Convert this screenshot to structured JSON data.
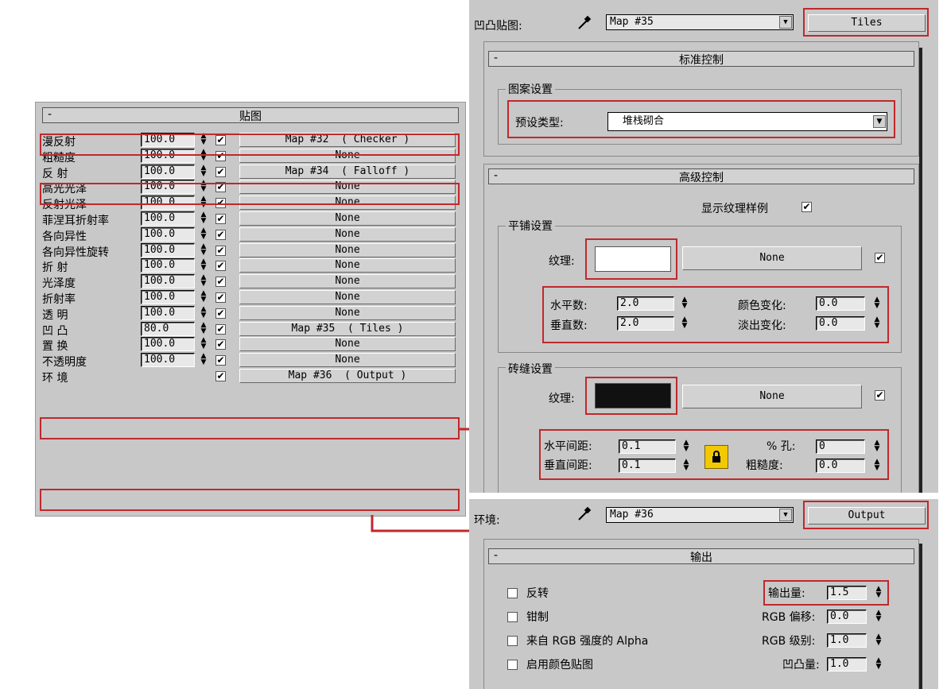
{
  "maps_rollout": {
    "collapse": "-",
    "title": "贴图",
    "rows": [
      {
        "label": "漫反射",
        "amount": "100.0",
        "map": "Map #32  ( Checker )"
      },
      {
        "label": "粗糙度",
        "amount": "100.0",
        "map": "None"
      },
      {
        "label": "反  射",
        "amount": "100.0",
        "map": "Map #34  ( Falloff )"
      },
      {
        "label": "高光光泽",
        "amount": "100.0",
        "map": "None"
      },
      {
        "label": "反射光泽",
        "amount": "100.0",
        "map": "None"
      },
      {
        "label": "菲涅耳折射率",
        "amount": "100.0",
        "map": "None"
      },
      {
        "label": "各向异性",
        "amount": "100.0",
        "map": "None"
      },
      {
        "label": "各向异性旋转",
        "amount": "100.0",
        "map": "None"
      },
      {
        "label": "折  射",
        "amount": "100.0",
        "map": "None"
      },
      {
        "label": "光泽度",
        "amount": "100.0",
        "map": "None"
      },
      {
        "label": "折射率",
        "amount": "100.0",
        "map": "None"
      },
      {
        "label": "透  明",
        "amount": "100.0",
        "map": "None"
      },
      {
        "label": "凹  凸",
        "amount": "80.0",
        "map": "Map #35  ( Tiles )"
      },
      {
        "label": "置  换",
        "amount": "100.0",
        "map": "None"
      },
      {
        "label": "不透明度",
        "amount": "100.0",
        "map": "None"
      },
      {
        "label": "环  境",
        "amount": "",
        "map": "Map #36  ( Output )"
      }
    ]
  },
  "bump_panel": {
    "label": "凹凸贴图:",
    "map_name": "Map #35",
    "type_button": "Tiles",
    "std_rollout": {
      "collapse": "-",
      "title": "标准控制",
      "pattern_group": "图案设置",
      "preset_label": "预设类型:",
      "preset_value": "堆栈砌合"
    },
    "adv_rollout": {
      "collapse": "-",
      "title": "高级控制",
      "show_sample_label": "显示纹理样例",
      "tiles_group": "平铺设置",
      "tiles_texture_label": "纹理:",
      "tiles_texture_map": "None",
      "horiz_count_label": "水平数:",
      "horiz_count": "2.0",
      "vert_count_label": "垂直数:",
      "vert_count": "2.0",
      "color_var_label": "颜色变化:",
      "color_var": "0.0",
      "fade_var_label": "淡出变化:",
      "fade_var": "0.0",
      "grout_group": "砖缝设置",
      "grout_texture_label": "纹理:",
      "grout_texture_map": "None",
      "horiz_gap_label": "水平间距:",
      "horiz_gap": "0.1",
      "vert_gap_label": "垂直间距:",
      "vert_gap": "0.1",
      "holes_label": "% 孔:",
      "holes": "0",
      "rough_label": "粗糙度:",
      "rough": "0.0"
    },
    "colors": {
      "tiles_color": "#ffffff",
      "grout_color": "#111111",
      "lock_color": "#f2c800"
    }
  },
  "env_panel": {
    "label": "环境:",
    "map_name": "Map #36",
    "type_button": "Output",
    "output_rollout": {
      "collapse": "-",
      "title": "输出",
      "invert": "反转",
      "clamp": "钳制",
      "alpha_from_rgb": "来自 RGB 强度的 Alpha",
      "enable_color_map": "启用颜色贴图",
      "output_amount_label": "输出量:",
      "output_amount": "1.5",
      "rgb_offset_label": "RGB 偏移:",
      "rgb_offset": "0.0",
      "rgb_level_label": "RGB 级别:",
      "rgb_level": "1.0",
      "bump_amount_label": "凹凸量:",
      "bump_amount": "1.0"
    }
  },
  "icons": {
    "check": "✔",
    "dropdown": "▼",
    "spinner": "▲▼",
    "eyedropper": "eyedropper-icon",
    "lock": "lock-icon"
  },
  "accent_color": "#c0282c"
}
